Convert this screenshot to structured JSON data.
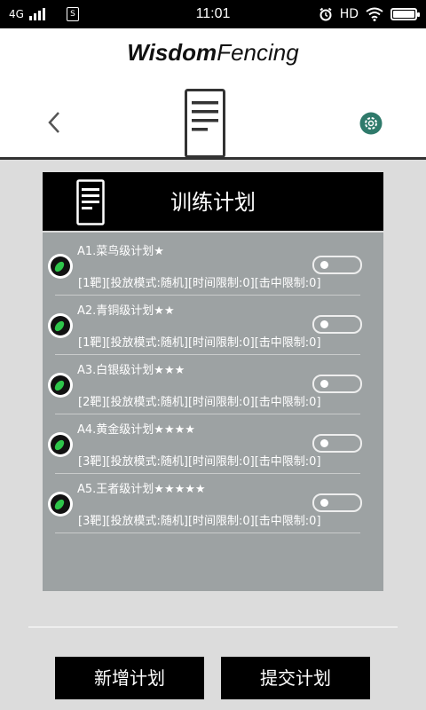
{
  "status_bar": {
    "network": "4G",
    "sim_label": "S",
    "time": "11:01",
    "hd_label": "HD",
    "icons": [
      "signal-icon",
      "sim-icon",
      "alarm-icon",
      "wifi-icon",
      "battery-icon"
    ]
  },
  "header": {
    "brand_bold": "Wisdom",
    "brand_regular": "Fencing",
    "icons": [
      "back-arrow-icon",
      "document-list-icon",
      "settings-gear-icon"
    ]
  },
  "panel": {
    "title": "训练计划",
    "plans": [
      {
        "name": "A1.菜鸟级计划★",
        "desc": "[1靶][投放模式:随机][时间限制:0][击中限制:0]",
        "enabled": false
      },
      {
        "name": "A2.青铜级计划★★",
        "desc": "[1靶][投放模式:随机][时间限制:0][击中限制:0]",
        "enabled": false
      },
      {
        "name": "A3.白银级计划★★★",
        "desc": "[2靶][投放模式:随机][时间限制:0][击中限制:0]",
        "enabled": false
      },
      {
        "name": "A4.黄金级计划★★★★",
        "desc": "[3靶][投放模式:随机][时间限制:0][击中限制:0]",
        "enabled": false
      },
      {
        "name": "A5.王者级计划★★★★★",
        "desc": "[3靶][投放模式:随机][时间限制:0][击中限制:0]",
        "enabled": false
      }
    ]
  },
  "buttons": {
    "add_plan": "新增计划",
    "submit_plan": "提交计划"
  },
  "colors": {
    "panel_bg": "#9da2a3",
    "background": "#dcdcdc",
    "edit_leaf": "#2ec54a",
    "gear": "#2f7a6b"
  }
}
